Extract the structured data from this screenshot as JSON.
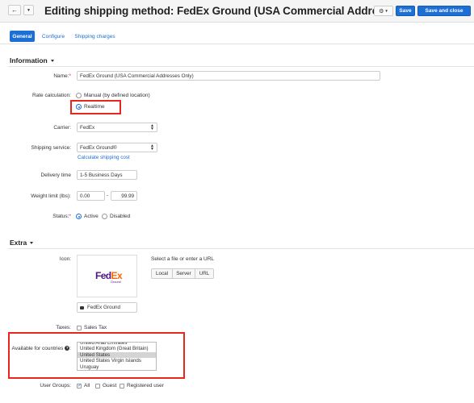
{
  "header": {
    "title": "Editing shipping method: FedEx Ground (USA Commercial Addre...",
    "back_icon": "back-arrow-icon",
    "dropdown_icon": "caret-down-icon",
    "settings_icon": "gear-icon",
    "save_label": "Save",
    "save_close_label": "Save and close"
  },
  "tabs": [
    {
      "label": "General",
      "active": true
    },
    {
      "label": "Configure",
      "active": false
    },
    {
      "label": "Shipping charges",
      "active": false
    }
  ],
  "information": {
    "title": "Information",
    "name": {
      "label": "Name:",
      "value": "FedEx Ground (USA Commercial Addresses Only)"
    },
    "rate_calculation": {
      "label": "Rate calculation:",
      "options": [
        "Manual (by defined location)",
        "Realtime"
      ],
      "selected": "Realtime"
    },
    "carrier": {
      "label": "Carrier:",
      "value": "FedEx"
    },
    "shipping_service": {
      "label": "Shipping service:",
      "value": "FedEx Ground®",
      "link": "Calculate shipping cost"
    },
    "delivery_time": {
      "label": "Delivery time",
      "value": "1-5 Business Days"
    },
    "weight_limit": {
      "label": "Weight limit (lbs):",
      "min": "0.00",
      "separator": "-",
      "max": "99.99"
    },
    "status": {
      "label": "Status:",
      "options": [
        "Active",
        "Disabled"
      ],
      "selected": "Active"
    }
  },
  "extra": {
    "title": "Extra",
    "icon": {
      "label": "Icon:",
      "logo_fe": "Fed",
      "logo_ex": "Ex",
      "logo_sub": "Ground",
      "file_prompt": "Select a file or enter a URL",
      "buttons": [
        "Local",
        "Server",
        "URL"
      ],
      "alt_text": "FedEx Ground",
      "alt_icon": "comment-icon"
    },
    "taxes": {
      "label": "Taxes:",
      "option": "Sales Tax",
      "checked": false
    },
    "countries": {
      "label": "Available for countries",
      "help_icon": "question-icon",
      "options": [
        "United Arab Emirates",
        "United Kingdom (Great Britain)",
        "United States",
        "United States Virgin Islands",
        "Uruguay"
      ],
      "selected": "United States"
    },
    "user_groups": {
      "label": "User Groups:",
      "options": [
        {
          "label": "All",
          "checked": true
        },
        {
          "label": "Guest",
          "checked": false
        },
        {
          "label": "Registered user",
          "checked": false
        }
      ]
    }
  },
  "colors": {
    "accent": "#1c6fd6",
    "highlight": "#e8261c",
    "required": "#dd3333"
  }
}
